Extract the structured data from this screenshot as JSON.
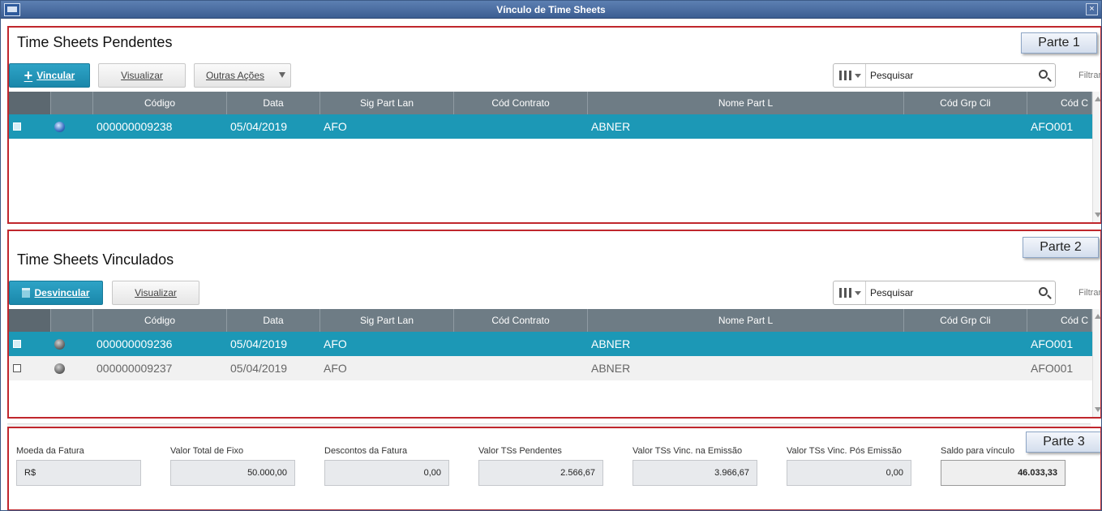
{
  "window": {
    "title": "Vínculo de Time Sheets"
  },
  "part_labels": {
    "part1": "Parte 1",
    "part2": "Parte 2",
    "part3": "Parte 3"
  },
  "pendentes": {
    "title": "Time Sheets Pendentes",
    "vincular_label": "Vincular",
    "visualizar_label": "Visualizar",
    "outras_acoes_label": "Outras Ações",
    "search_placeholder": "Pesquisar",
    "filtrar_label": "Filtrar",
    "columns": [
      "Código",
      "Data",
      "Sig Part Lan",
      "Cód Contrato",
      "Nome Part L",
      "Cód Grp Cli",
      "Cód C"
    ],
    "rows": [
      {
        "codigo": "000000009238",
        "data": "05/04/2019",
        "sig": "AFO",
        "contrato": "",
        "nome": "ABNER",
        "grp": "",
        "codc": "AFO001",
        "selected": true,
        "status": "blue"
      }
    ]
  },
  "vinculados": {
    "title": "Time Sheets Vinculados",
    "desvincular_label": "Desvincular",
    "visualizar_label": "Visualizar",
    "search_placeholder": "Pesquisar",
    "filtrar_label": "Filtrar",
    "columns": [
      "Código",
      "Data",
      "Sig Part Lan",
      "Cód Contrato",
      "Nome Part L",
      "Cód Grp Cli",
      "Cód C"
    ],
    "rows": [
      {
        "codigo": "000000009236",
        "data": "05/04/2019",
        "sig": "AFO",
        "contrato": "",
        "nome": "ABNER",
        "grp": "",
        "codc": "AFO001",
        "selected": true,
        "status": "gray"
      },
      {
        "codigo": "000000009237",
        "data": "05/04/2019",
        "sig": "AFO",
        "contrato": "",
        "nome": "ABNER",
        "grp": "",
        "codc": "AFO001",
        "selected": false,
        "status": "gray"
      }
    ]
  },
  "totais": {
    "moeda": {
      "label": "Moeda da Fatura",
      "value": "R$"
    },
    "valor_fixo": {
      "label": "Valor Total de Fixo",
      "value": "50.000,00"
    },
    "descontos": {
      "label": "Descontos da Fatura",
      "value": "0,00"
    },
    "ts_pendentes": {
      "label": "Valor TSs Pendentes",
      "value": "2.566,67"
    },
    "ts_emissao": {
      "label": "Valor TSs Vinc. na Emissão",
      "value": "3.966,67"
    },
    "ts_pos": {
      "label": "Valor TSs Vinc. Pós Emissão",
      "value": "0,00"
    },
    "saldo": {
      "label": "Saldo para vínculo",
      "value": "46.033,33"
    }
  },
  "icons": [
    "app-icon",
    "close-icon",
    "plus-icon",
    "trash-icon",
    "columns-icon",
    "search-icon",
    "status-dot-icon"
  ],
  "colors": {
    "titlebar": "#4a6da3",
    "primary": "#1c98b6",
    "grid_header": "#6e7c85",
    "highlight_border": "#c0272d"
  }
}
